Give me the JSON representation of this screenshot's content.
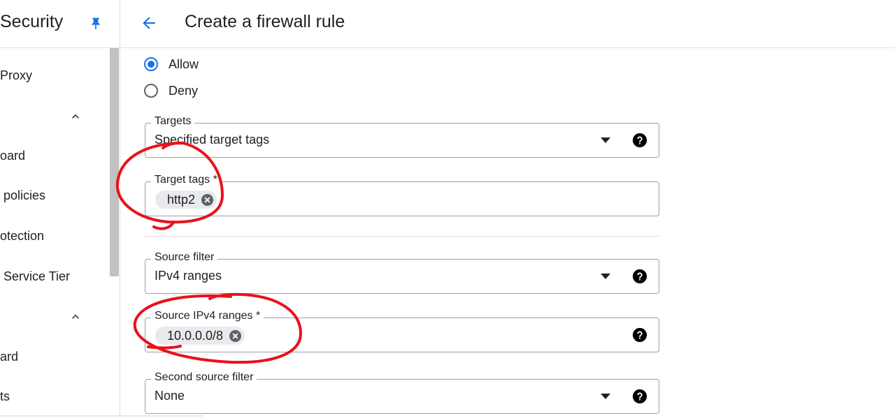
{
  "sidebar": {
    "title": "Security",
    "items": [
      {
        "label": "Proxy"
      },
      {
        "label": "oard"
      },
      {
        "label": "policies"
      },
      {
        "label": "otection"
      },
      {
        "label": "Service Tier"
      },
      {
        "label": "ard"
      },
      {
        "label": "ts"
      }
    ],
    "icons": {
      "pin": "pin-icon",
      "chevron": "chevron-up-icon"
    }
  },
  "header": {
    "title": "Create a firewall rule",
    "back_icon": "arrow-back-icon"
  },
  "action": {
    "options": [
      {
        "label": "Allow",
        "checked": true
      },
      {
        "label": "Deny",
        "checked": false
      }
    ]
  },
  "targets": {
    "label": "Targets",
    "value": "Specified target tags"
  },
  "target_tags": {
    "label": "Target tags *",
    "chips": [
      "http2"
    ]
  },
  "source_filter": {
    "label": "Source filter",
    "value": "IPv4 ranges"
  },
  "source_ranges": {
    "label": "Source IPv4 ranges *",
    "chips": [
      "10.0.0.0/8"
    ]
  },
  "second_source_filter": {
    "label": "Second source filter",
    "value": "None"
  },
  "colors": {
    "accent": "#1a73e8",
    "annotation": "#e8121b",
    "border": "#9aa0a6"
  }
}
